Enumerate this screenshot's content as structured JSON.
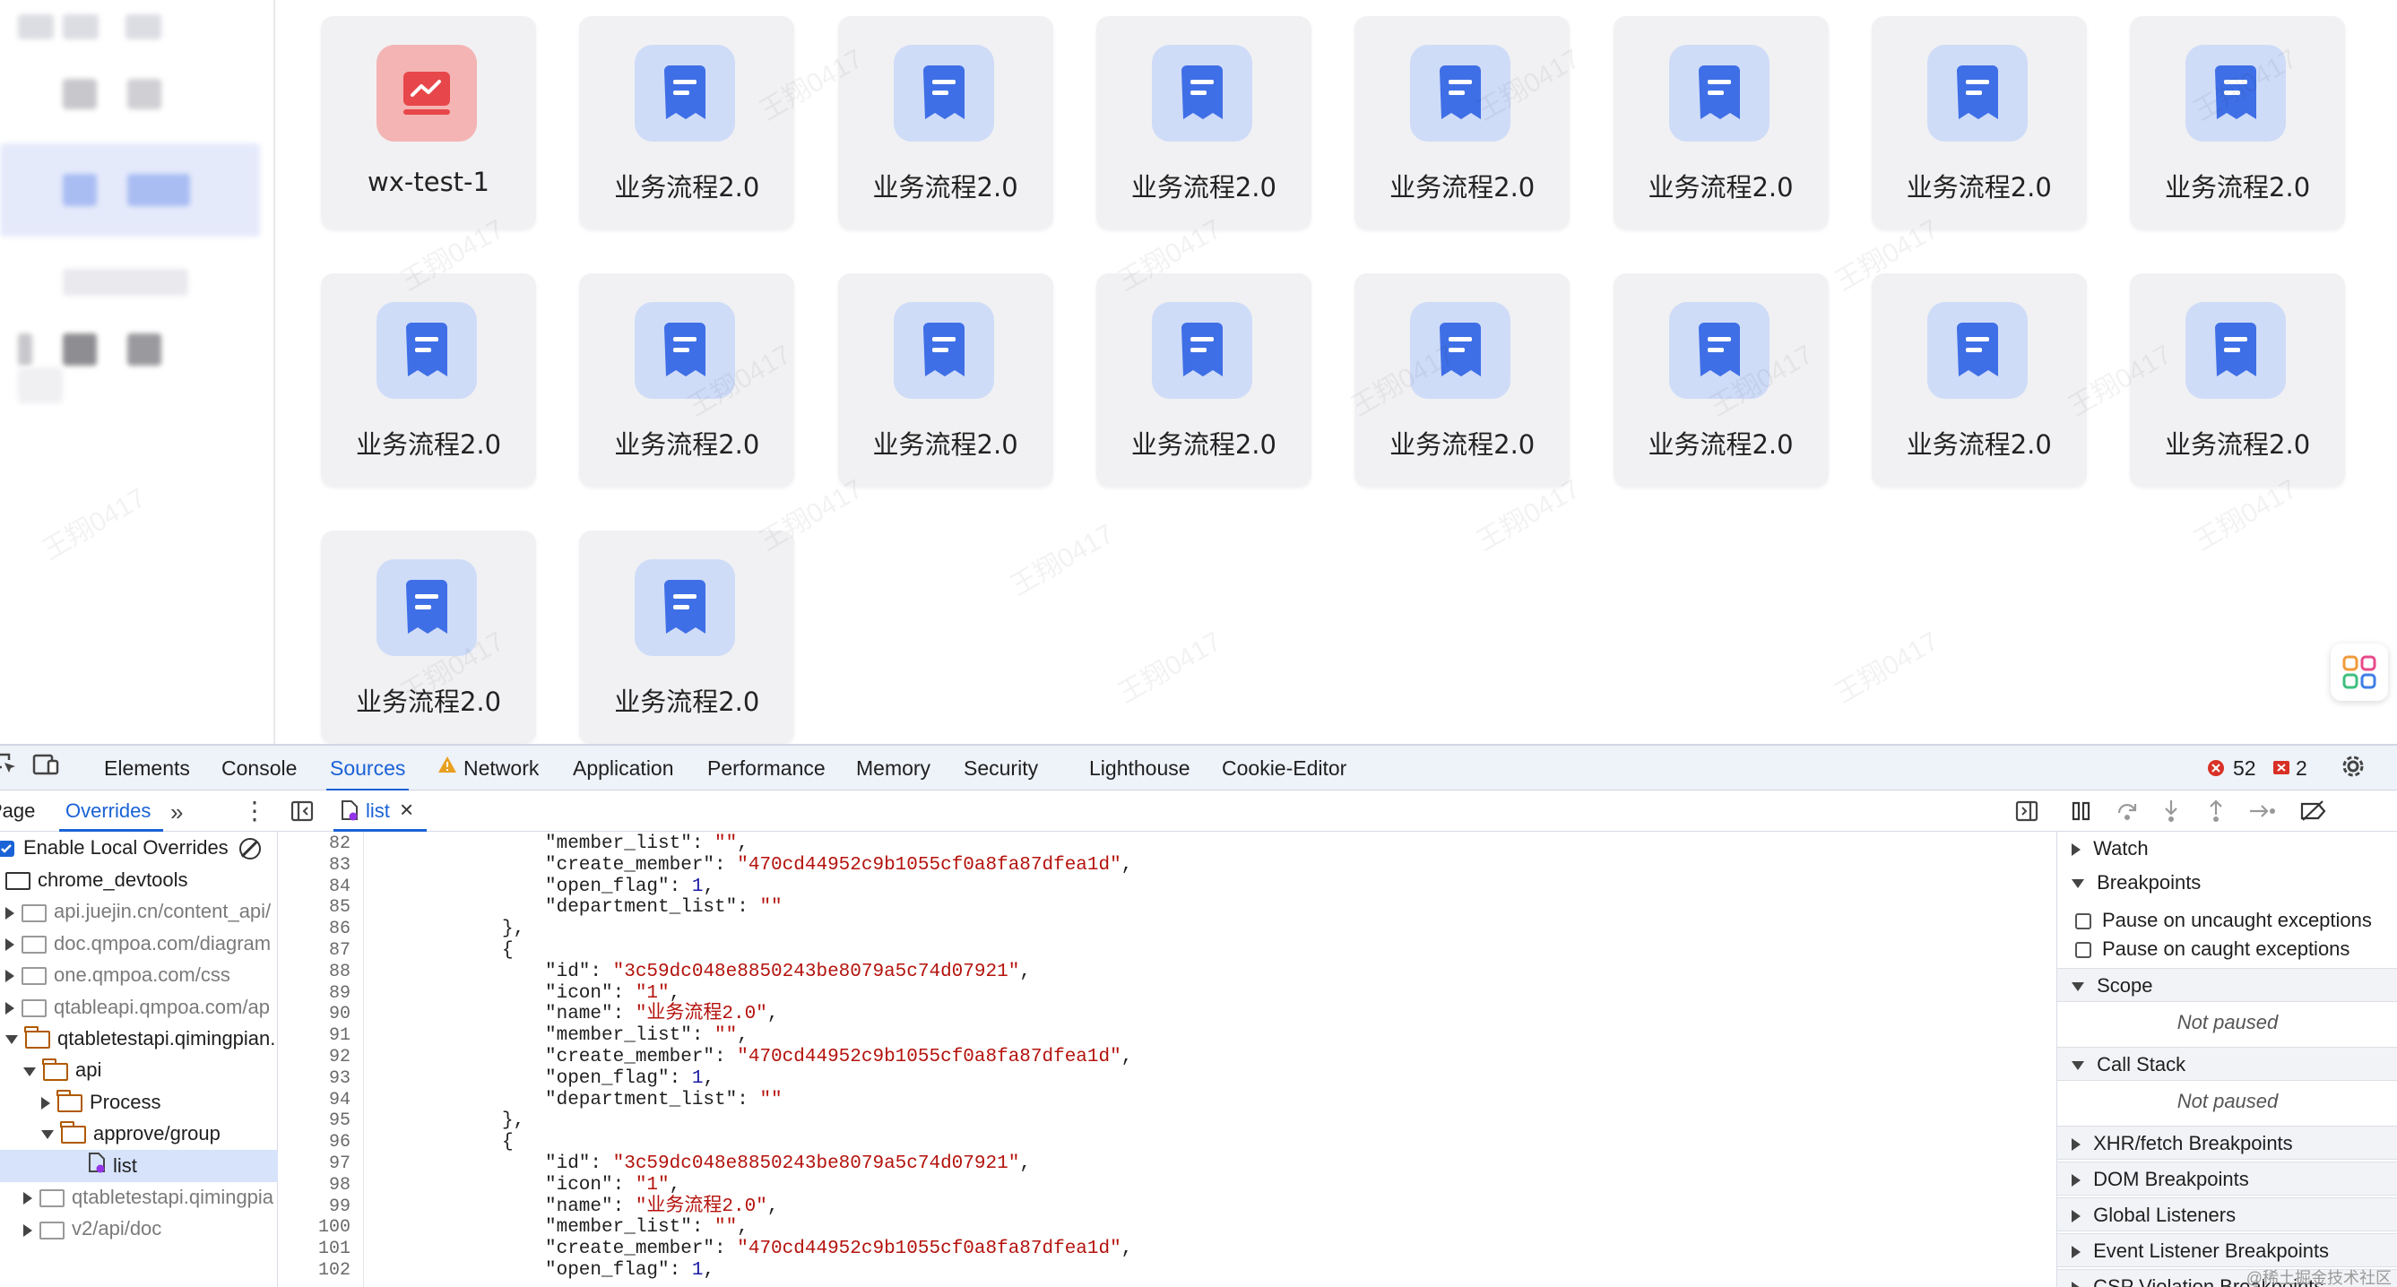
{
  "app": {
    "cards": [
      {
        "label": "wx-test-1",
        "icon": "chart-icon",
        "color": "#e7474a"
      },
      {
        "label": "业务流程2.0",
        "icon": "document-icon",
        "color": "#3f6fe6"
      },
      {
        "label": "业务流程2.0",
        "icon": "document-icon",
        "color": "#3f6fe6"
      },
      {
        "label": "业务流程2.0",
        "icon": "document-icon",
        "color": "#3f6fe6"
      },
      {
        "label": "业务流程2.0",
        "icon": "document-icon",
        "color": "#3f6fe6"
      },
      {
        "label": "业务流程2.0",
        "icon": "document-icon",
        "color": "#3f6fe6"
      },
      {
        "label": "业务流程2.0",
        "icon": "document-icon",
        "color": "#3f6fe6"
      },
      {
        "label": "业务流程2.0",
        "icon": "document-icon",
        "color": "#3f6fe6"
      },
      {
        "label": "业务流程2.0",
        "icon": "document-icon",
        "color": "#3f6fe6"
      },
      {
        "label": "业务流程2.0",
        "icon": "document-icon",
        "color": "#3f6fe6"
      },
      {
        "label": "业务流程2.0",
        "icon": "document-icon",
        "color": "#3f6fe6"
      },
      {
        "label": "业务流程2.0",
        "icon": "document-icon",
        "color": "#3f6fe6"
      },
      {
        "label": "业务流程2.0",
        "icon": "document-icon",
        "color": "#3f6fe6"
      },
      {
        "label": "业务流程2.0",
        "icon": "document-icon",
        "color": "#3f6fe6"
      },
      {
        "label": "业务流程2.0",
        "icon": "document-icon",
        "color": "#3f6fe6"
      },
      {
        "label": "业务流程2.0",
        "icon": "document-icon",
        "color": "#3f6fe6"
      },
      {
        "label": "业务流程2.0",
        "icon": "document-icon",
        "color": "#3f6fe6"
      },
      {
        "label": "业务流程2.0",
        "icon": "document-icon",
        "color": "#3f6fe6"
      }
    ],
    "watermark": "王翔0417",
    "floating_button_icon": "apps-grid-icon"
  },
  "devtools": {
    "tabs": [
      "Elements",
      "Console",
      "Sources",
      "Network",
      "Application",
      "Performance",
      "Memory",
      "Security",
      "Lighthouse",
      "Cookie-Editor"
    ],
    "active_tab": "Sources",
    "network_warning_icon": "warning-icon",
    "error_count": "52",
    "issue_count": "2",
    "navigator_tabs": {
      "page": "Page",
      "overrides": "Overrides"
    },
    "open_file": "list",
    "enable_overrides_label": "Enable Local Overrides",
    "tree": [
      {
        "label": "chrome_devtools",
        "grey": false
      },
      {
        "label": "api.juejin.cn/content_api/",
        "grey": true
      },
      {
        "label": "doc.qmpoa.com/diagram",
        "grey": true
      },
      {
        "label": "one.qmpoa.com/css",
        "grey": true
      },
      {
        "label": "qtableapi.qmpoa.com/ap",
        "grey": true
      },
      {
        "label": "qtabletestapi.qimingpian.",
        "grey": false
      },
      {
        "label": "api",
        "grey": false
      },
      {
        "label": "Process",
        "grey": false
      },
      {
        "label": "approve/group",
        "grey": false
      },
      {
        "label": "list",
        "grey": false
      },
      {
        "label": "qtabletestapi.qimingpia",
        "grey": true
      },
      {
        "label": "v2/api/doc",
        "grey": true
      }
    ],
    "code_lines": [
      {
        "n": "82",
        "k": "\"member_list\": ",
        "v": "\"\"",
        "t": "str",
        "e": ","
      },
      {
        "n": "83",
        "k": "\"create_member\": ",
        "v": "\"470cd44952c9b1055cf0a8fa87dfea1d\"",
        "t": "str",
        "e": ","
      },
      {
        "n": "84",
        "k": "\"open_flag\": ",
        "v": "1",
        "t": "num",
        "e": ","
      },
      {
        "n": "85",
        "k": "\"department_list\": ",
        "v": "\"\"",
        "t": "str",
        "e": ""
      },
      {
        "n": "86",
        "k": "},",
        "v": "",
        "t": "",
        "e": ""
      },
      {
        "n": "87",
        "k": "{",
        "v": "",
        "t": "",
        "e": ""
      },
      {
        "n": "88",
        "k": "\"id\": ",
        "v": "\"3c59dc048e8850243be8079a5c74d07921\"",
        "t": "str",
        "e": ","
      },
      {
        "n": "89",
        "k": "\"icon\": ",
        "v": "\"1\"",
        "t": "str",
        "e": ","
      },
      {
        "n": "90",
        "k": "\"name\": ",
        "v": "\"业务流程2.0\"",
        "t": "str",
        "e": ","
      },
      {
        "n": "91",
        "k": "\"member_list\": ",
        "v": "\"\"",
        "t": "str",
        "e": ","
      },
      {
        "n": "92",
        "k": "\"create_member\": ",
        "v": "\"470cd44952c9b1055cf0a8fa87dfea1d\"",
        "t": "str",
        "e": ","
      },
      {
        "n": "93",
        "k": "\"open_flag\": ",
        "v": "1",
        "t": "num",
        "e": ","
      },
      {
        "n": "94",
        "k": "\"department_list\": ",
        "v": "\"\"",
        "t": "str",
        "e": ""
      },
      {
        "n": "95",
        "k": "},",
        "v": "",
        "t": "",
        "e": ""
      },
      {
        "n": "96",
        "k": "{",
        "v": "",
        "t": "",
        "e": ""
      },
      {
        "n": "97",
        "k": "\"id\": ",
        "v": "\"3c59dc048e8850243be8079a5c74d07921\"",
        "t": "str",
        "e": ","
      },
      {
        "n": "98",
        "k": "\"icon\": ",
        "v": "\"1\"",
        "t": "str",
        "e": ","
      },
      {
        "n": "99",
        "k": "\"name\": ",
        "v": "\"业务流程2.0\"",
        "t": "str",
        "e": ","
      },
      {
        "n": "100",
        "k": "\"member_list\": ",
        "v": "\"\"",
        "t": "str",
        "e": ","
      },
      {
        "n": "101",
        "k": "\"create_member\": ",
        "v": "\"470cd44952c9b1055cf0a8fa87dfea1d\"",
        "t": "str",
        "e": ","
      },
      {
        "n": "102",
        "k": "\"open_flag\": ",
        "v": "1",
        "t": "num",
        "e": ","
      }
    ],
    "debugger": {
      "watch": "Watch",
      "breakpoints": "Breakpoints",
      "pause_uncaught": "Pause on uncaught exceptions",
      "pause_caught": "Pause on caught exceptions",
      "scope": "Scope",
      "not_paused": "Not paused",
      "call_stack": "Call Stack",
      "call_stack_status": "Not paused",
      "xhr": "XHR/fetch Breakpoints",
      "dom": "DOM Breakpoints",
      "global": "Global Listeners",
      "event": "Event Listener Breakpoints",
      "csp": "CSP Violation Breakpoints"
    },
    "corner_watermark": "@稀土掘金技术社区"
  }
}
